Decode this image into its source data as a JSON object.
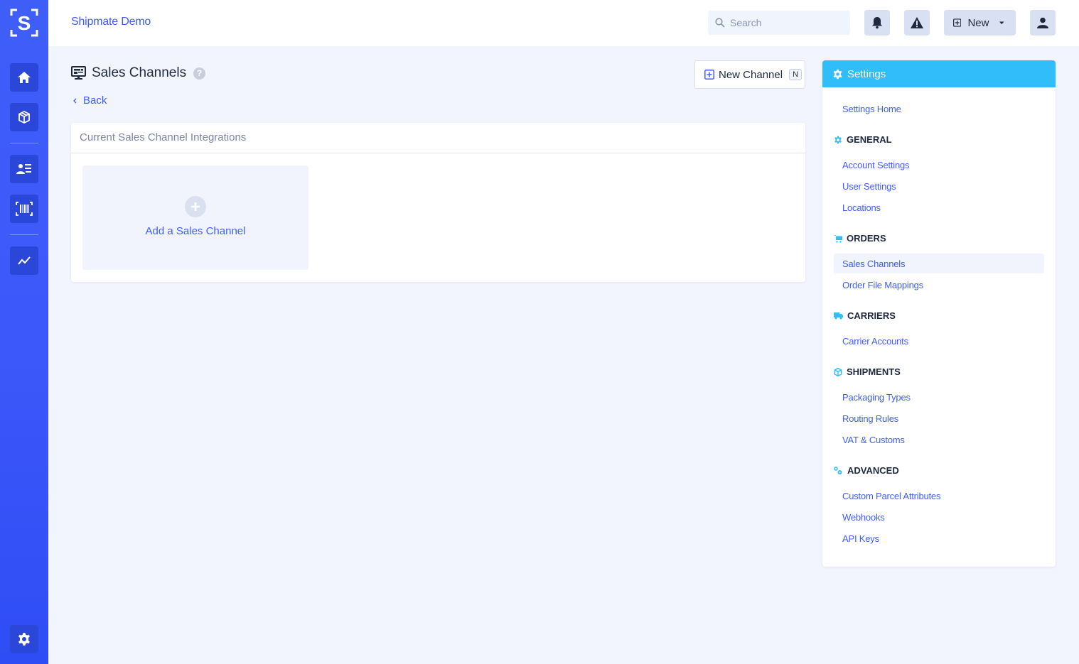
{
  "app": {
    "org_name": "Shipmate Demo"
  },
  "rail": {
    "items": [
      {
        "name": "home",
        "icon": "home-icon"
      },
      {
        "name": "shipments",
        "icon": "package-icon"
      },
      {
        "name": "contacts",
        "icon": "contacts-icon"
      },
      {
        "name": "scan",
        "icon": "barcode-icon"
      },
      {
        "name": "reports",
        "icon": "chart-line-icon"
      },
      {
        "name": "settings",
        "icon": "gear-icon"
      }
    ]
  },
  "topbar": {
    "search_placeholder": "Search",
    "new_label": "New"
  },
  "page": {
    "title": "Sales Channels",
    "help": "?",
    "back_label": "Back",
    "new_channel_label": "New Channel",
    "new_channel_shortcut": "N"
  },
  "card": {
    "header": "Current Sales Channel Integrations",
    "add_label": "Add a Sales Channel"
  },
  "settings": {
    "title": "Settings",
    "home": "Settings Home",
    "sections": [
      {
        "title": "GENERAL",
        "items": [
          "Account Settings",
          "User Settings",
          "Locations"
        ]
      },
      {
        "title": "ORDERS",
        "items": [
          "Sales Channels",
          "Order File Mappings"
        ]
      },
      {
        "title": "CARRIERS",
        "items": [
          "Carrier Accounts"
        ]
      },
      {
        "title": "SHIPMENTS",
        "items": [
          "Packaging Types",
          "Routing Rules",
          "VAT & Customs"
        ]
      },
      {
        "title": "ADVANCED",
        "items": [
          "Custom Parcel Attributes",
          "Webhooks",
          "API Keys"
        ]
      }
    ],
    "active_item": "Sales Channels"
  },
  "colors": {
    "brand": "#3f5ef8",
    "settings_header": "#31bdf9",
    "background": "#f2f5fd"
  }
}
